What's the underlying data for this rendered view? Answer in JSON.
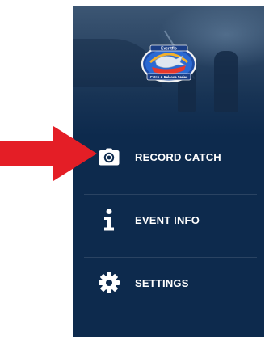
{
  "app": {
    "logo_icon": "tournament-logo",
    "logo_top_text": "Eventflo",
    "logo_bottom_text": "Catch & Release Series"
  },
  "menu": {
    "items": [
      {
        "label": "RECORD CATCH",
        "icon": "camera-icon"
      },
      {
        "label": "EVENT INFO",
        "icon": "info-icon"
      },
      {
        "label": "SETTINGS",
        "icon": "gear-icon"
      }
    ]
  },
  "annotation": {
    "arrow_icon": "red-arrow-icon",
    "arrow_color": "#e41e26"
  },
  "colors": {
    "drawer_background": "#0d2a4d",
    "menu_text": "#ffffff"
  }
}
